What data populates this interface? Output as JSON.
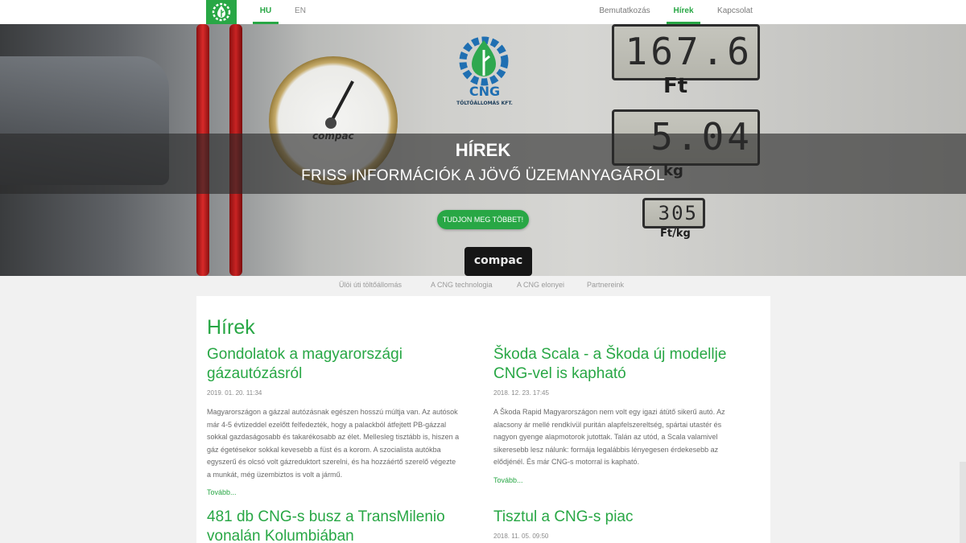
{
  "nav": {
    "languages": [
      {
        "label": "HU",
        "active": true
      },
      {
        "label": "EN",
        "active": false
      }
    ],
    "items": [
      {
        "label": "Bemutatkozás",
        "active": false
      },
      {
        "label": "Hírek",
        "active": true
      },
      {
        "label": "Kapcsolat",
        "active": false
      }
    ],
    "logo_icon": "cng-drop-logo-icon"
  },
  "hero": {
    "title": "HÍREK",
    "subtitle": "FRISS INFORMÁCIÓK A JÖVŐ ÜZEMANYAGÁRÓL",
    "button_label": "TUDJON MEG TÖBBET!",
    "photo": {
      "logo_text": "CNG",
      "logo_sub": "TÖLTŐÁLLOMÁS KFT.",
      "display_total": "167.6",
      "display_unit_1": "Ft",
      "display_qty": "5.04",
      "display_unit_2": "kg",
      "display_price": "305",
      "display_unit_3": "Ft/kg",
      "brand": "compac",
      "gauge_brand": "compac"
    }
  },
  "subnav": [
    {
      "label": "Ülöi úti töltőállomás"
    },
    {
      "label": "A CNG technologia"
    },
    {
      "label": "A CNG elonyei"
    },
    {
      "label": "Partnereink"
    }
  ],
  "main": {
    "title": "Hírek",
    "more_label": "Tovább...",
    "articles": [
      {
        "title_line1": "Gondolatok a magyarországi",
        "title_line2": "gázautózásról",
        "date": "2019. 01. 20. 11:34",
        "body": [
          "Magyarországon a gázzal autózásnak egészen hosszú múltja van. Az autósok",
          "már 4-5 évtizeddel ezelőtt felfedezték, hogy a palackból átfejtett PB-gázzal",
          "sokkal gazdaságosabb és takarékosabb az élet. Mellesleg tisztább is, hiszen a",
          "gáz égetésekor sokkal kevesebb a füst és a korom. A szocialista autókba",
          "egyszerű és olcsó volt gázreduktort szerelni, és ha hozzáértő szerelő végezte",
          "a munkát, még üzembiztos is volt a jármű."
        ]
      },
      {
        "title_line1": "Škoda Scala - a Škoda új modellje",
        "title_line2": "CNG-vel is kapható",
        "date": "2018. 12. 23. 17:45",
        "body": [
          "A Škoda Rapid Magyarországon nem volt egy igazi átütő sikerű autó. Az",
          "alacsony ár mellé rendkívül puritán alapfelszereltség, spártai utastér és",
          "nagyon gyenge alapmotorok jutottak. Talán az utód, a Scala valamivel",
          "sikeresebb lesz nálunk: formája legalábbis lényegesen érdekesebb az",
          "elődjénél. És már CNG-s motorral is kapható."
        ]
      },
      {
        "title_line1": "481 db CNG-s busz a TransMilenio",
        "title_line2": "vonalán Kolumbiában"
      },
      {
        "title_line1": "Tisztul a CNG-s piac",
        "date": "2018. 11. 05. 09:50"
      }
    ]
  },
  "colors": {
    "accent": "#28a745",
    "text": "#6a6a6a",
    "muted": "#8a8a8a",
    "band": "rgba(40,40,40,0.62)"
  }
}
